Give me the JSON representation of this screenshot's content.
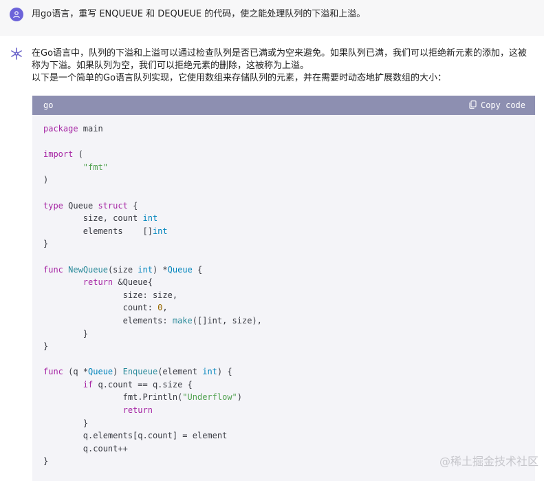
{
  "user_message": "用go语言，重写 ENQUEUE 和 DEQUEUE 的代码，使之能处理队列的下溢和上溢。",
  "assistant": {
    "paragraph1": "在Go语言中，队列的下溢和上溢可以通过检查队列是否已满或为空来避免。如果队列已满，我们可以拒绝新元素的添加，这被称为下溢。如果队列为空，我们可以拒绝元素的删除，这被称为上溢。",
    "paragraph2": "以下是一个简单的Go语言队列实现，它使用数组来存储队列的元素，并在需要时动态地扩展数组的大小："
  },
  "code_block": {
    "language": "go",
    "copy_label": "Copy code",
    "lines": [
      [
        [
          "kw",
          "package"
        ],
        [
          "plain",
          " main"
        ]
      ],
      [],
      [
        [
          "kw",
          "import"
        ],
        [
          "plain",
          " ("
        ]
      ],
      [
        [
          "plain",
          "        "
        ],
        [
          "str",
          "\"fmt\""
        ]
      ],
      [
        [
          "plain",
          ")"
        ]
      ],
      [],
      [
        [
          "kw",
          "type"
        ],
        [
          "plain",
          " Queue "
        ],
        [
          "kw",
          "struct"
        ],
        [
          "plain",
          " {"
        ]
      ],
      [
        [
          "plain",
          "        size, count "
        ],
        [
          "kw2",
          "int"
        ]
      ],
      [
        [
          "plain",
          "        elements    []"
        ],
        [
          "kw2",
          "int"
        ]
      ],
      [
        [
          "plain",
          "}"
        ]
      ],
      [],
      [
        [
          "kw",
          "func"
        ],
        [
          "plain",
          " "
        ],
        [
          "fn",
          "NewQueue"
        ],
        [
          "plain",
          "(size "
        ],
        [
          "kw2",
          "int"
        ],
        [
          "plain",
          ") *"
        ],
        [
          "kw2",
          "Queue"
        ],
        [
          "plain",
          " {"
        ]
      ],
      [
        [
          "plain",
          "        "
        ],
        [
          "kw",
          "return"
        ],
        [
          "plain",
          " &Queue{"
        ]
      ],
      [
        [
          "plain",
          "                size: size,"
        ]
      ],
      [
        [
          "plain",
          "                count: "
        ],
        [
          "num",
          "0"
        ],
        [
          "plain",
          ","
        ]
      ],
      [
        [
          "plain",
          "                elements: "
        ],
        [
          "fn",
          "make"
        ],
        [
          "plain",
          "([]int, size),"
        ]
      ],
      [
        [
          "plain",
          "        }"
        ]
      ],
      [
        [
          "plain",
          "}"
        ]
      ],
      [],
      [
        [
          "kw",
          "func"
        ],
        [
          "plain",
          " (q *"
        ],
        [
          "kw2",
          "Queue"
        ],
        [
          "plain",
          ") "
        ],
        [
          "fn",
          "Enqueue"
        ],
        [
          "plain",
          "(element "
        ],
        [
          "kw2",
          "int"
        ],
        [
          "plain",
          ") {"
        ]
      ],
      [
        [
          "plain",
          "        "
        ],
        [
          "kw",
          "if"
        ],
        [
          "plain",
          " q.count == q.size {"
        ]
      ],
      [
        [
          "plain",
          "                fmt.Println("
        ],
        [
          "str",
          "\"Underflow\""
        ],
        [
          "plain",
          ")"
        ]
      ],
      [
        [
          "plain",
          "                "
        ],
        [
          "kw",
          "return"
        ]
      ],
      [
        [
          "plain",
          "        }"
        ]
      ],
      [
        [
          "plain",
          "        q.elements[q.count] = element"
        ]
      ],
      [
        [
          "plain",
          "        q.count++"
        ]
      ],
      [
        [
          "plain",
          "}"
        ]
      ]
    ]
  },
  "watermark": "@稀土掘金技术社区",
  "colors": {
    "user_row_bg": "#f7f7f8",
    "avatar_user": "#6c63d9",
    "code_header_bg": "#8d8fb1",
    "code_bg": "#f4f4f8",
    "keyword": "#a626a4",
    "type": "#0184bc",
    "function": "#2a8a9a",
    "string": "#50a14f",
    "number": "#986801"
  },
  "icons": {
    "user_avatar": "person-icon",
    "assistant_avatar": "openai-logo-icon",
    "copy": "clipboard-icon"
  }
}
